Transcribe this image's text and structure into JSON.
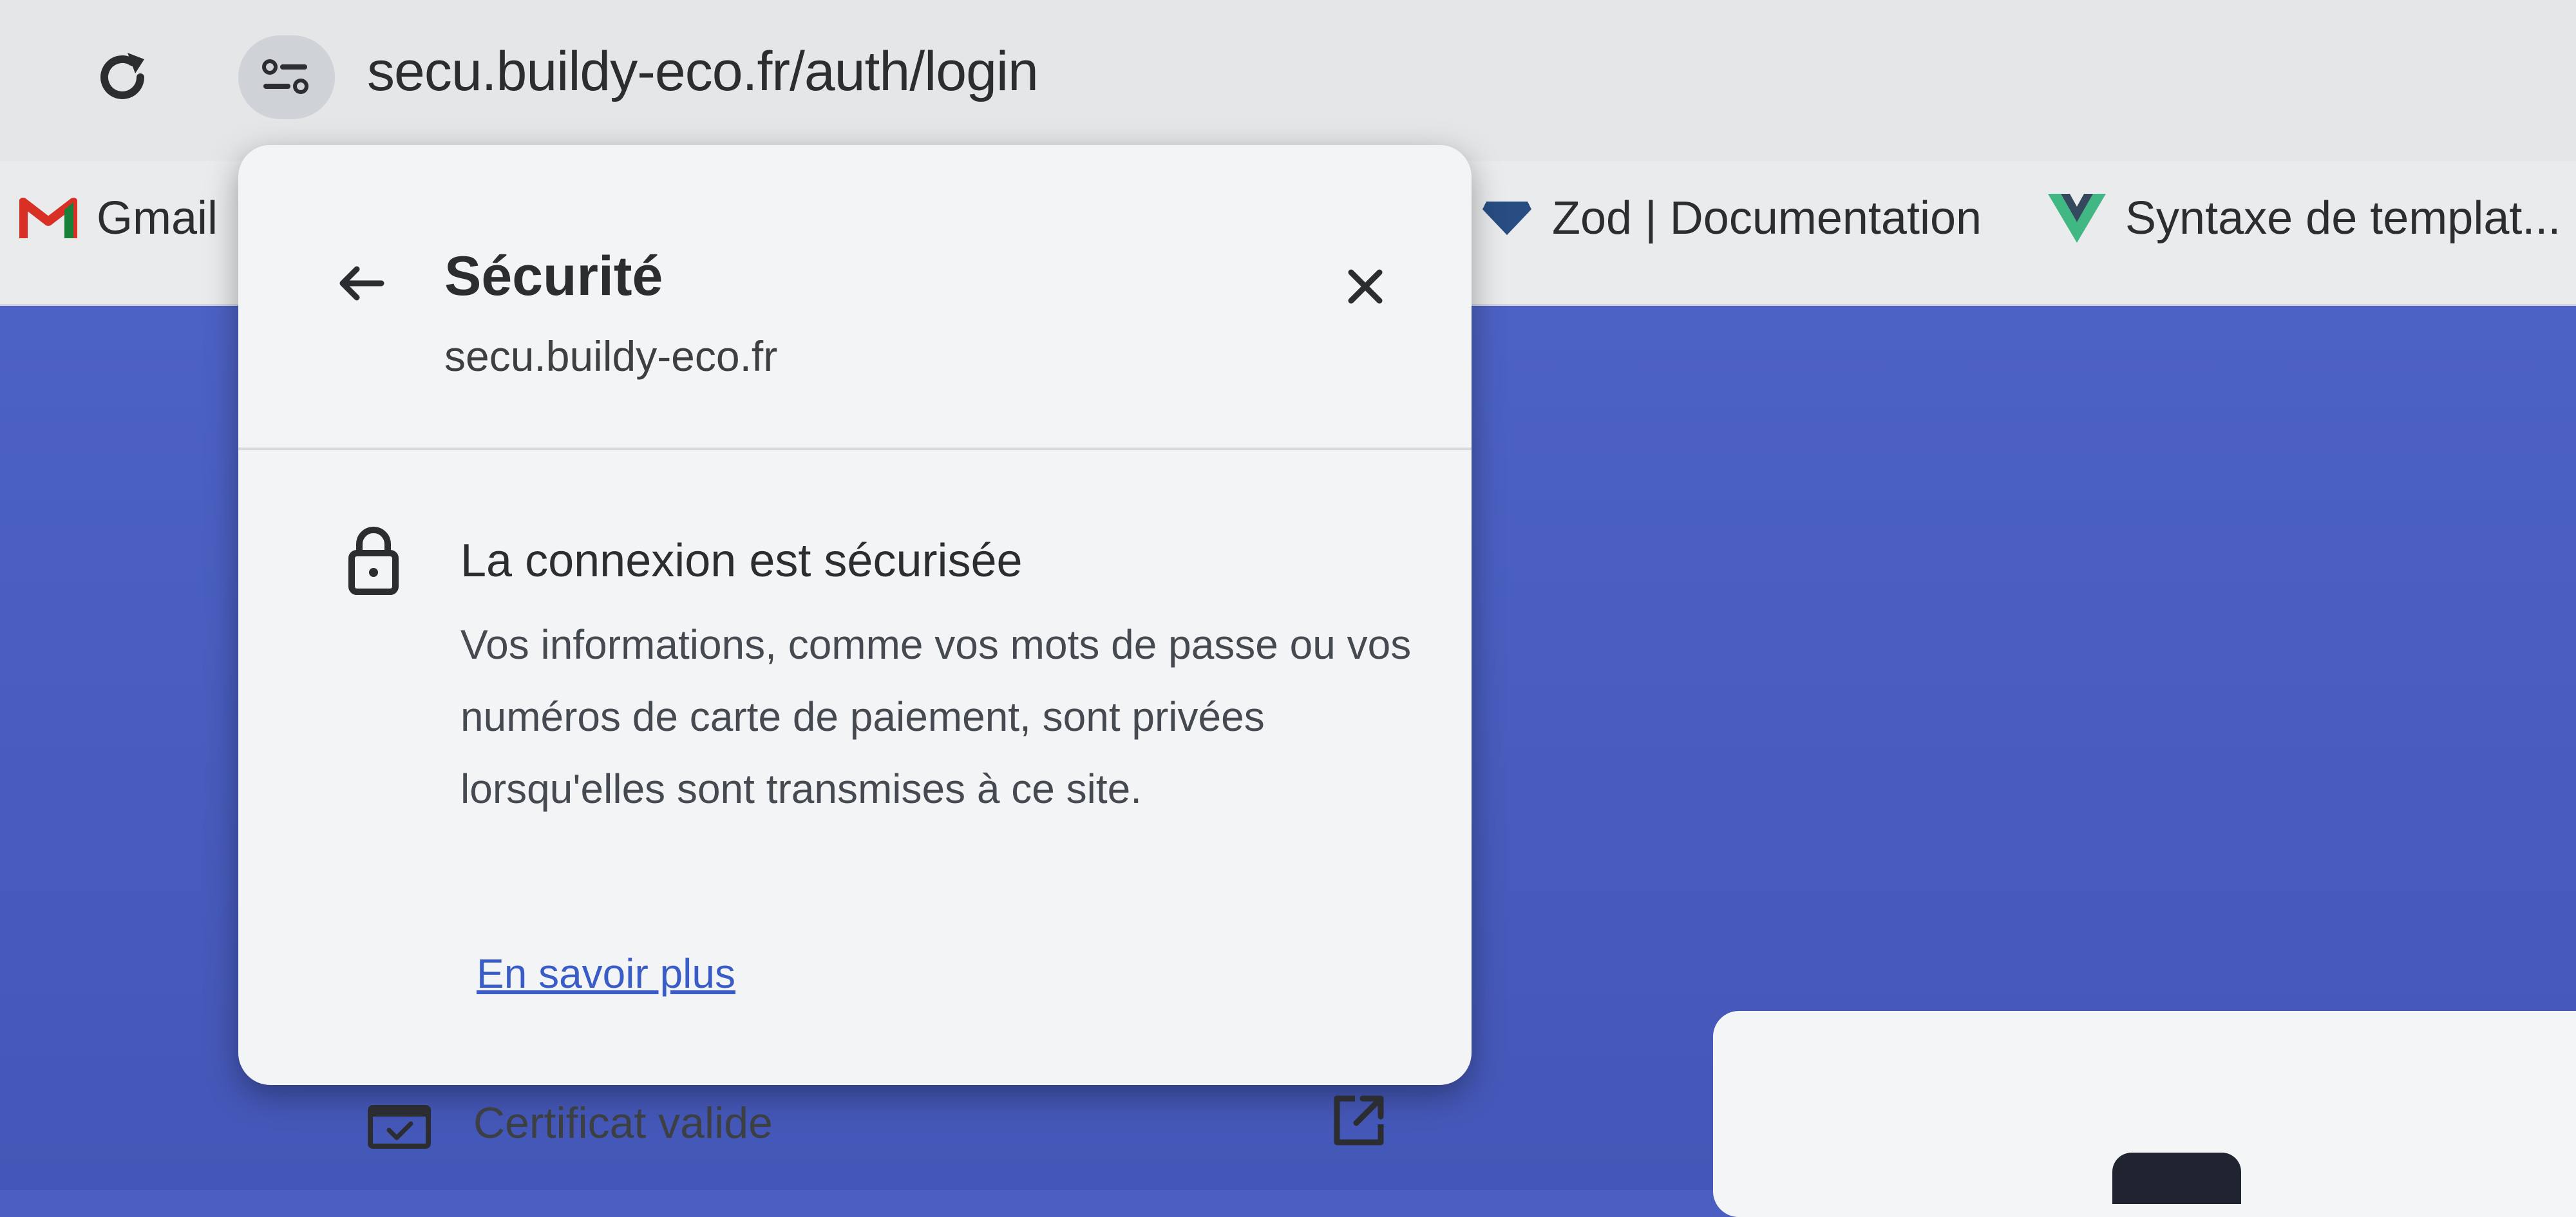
{
  "browser": {
    "url": "secu.buildy-eco.fr/auth/login",
    "icons": {
      "reload": "reload-icon",
      "site_info": "tune-icon"
    }
  },
  "bookmarks": [
    {
      "label": "Gmail",
      "icon": "gmail-icon"
    },
    {
      "label": "Zod | Documentation",
      "icon": "zod-icon"
    },
    {
      "label": "Syntaxe de templat...",
      "icon": "vue-icon"
    }
  ],
  "security_popup": {
    "title": "Sécurité",
    "domain": "secu.buildy-eco.fr",
    "connection_title": "La connexion est sécurisée",
    "connection_description": "Vos informations, comme vos mots de passe ou vos numéros de carte de paiement, sont privées lorsqu'elles sont transmises à ce site.",
    "learn_more": "En savoir plus",
    "certificate_label": "Certificat valide",
    "icons": {
      "back": "back-arrow-icon",
      "close": "close-icon",
      "lock": "lock-icon",
      "certificate": "certificate-icon",
      "external": "open-external-icon"
    }
  },
  "colors": {
    "page_background": "#4a5fc0",
    "popup_background": "#f3f4f6",
    "link": "#3a5cc6"
  }
}
